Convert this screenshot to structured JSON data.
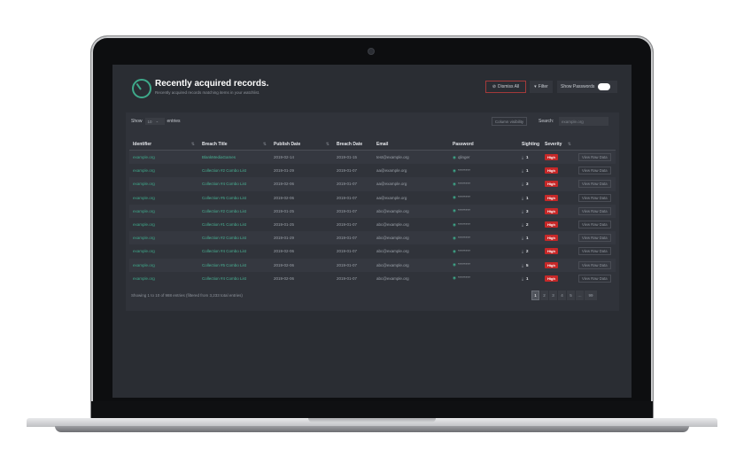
{
  "header": {
    "title": "Recently acquired records.",
    "subtitle": "Recently acquired records matching items in your watchlist.",
    "dismiss_label": "Dismiss All",
    "filter_label": "Filter",
    "show_passwords_label": "Show Passwords"
  },
  "controls": {
    "show_label": "Show",
    "entries_value": "10",
    "entries_label": "entries",
    "column_visibility_label": "Column visibility",
    "search_label": "Search:",
    "search_placeholder": "example.org"
  },
  "table": {
    "columns": [
      "Identifier",
      "Breach Title",
      "Publish Date",
      "Breach Date",
      "Email",
      "Password",
      "Sighting",
      "Severity",
      ""
    ],
    "rows": [
      {
        "identifier": "example.org",
        "breach": "BlankMediaGames",
        "publish": "2019-02-14",
        "breach_date": "2019-01-15",
        "email": "test@example.org",
        "password": "qlinger",
        "sighting": "1",
        "severity": "High",
        "action": "View Raw Data"
      },
      {
        "identifier": "example.org",
        "breach": "Collection #2 Combo List",
        "publish": "2019-01-29",
        "breach_date": "2019-01-07",
        "email": "aa@example.org",
        "password": "********",
        "sighting": "1",
        "severity": "High",
        "action": "View Raw Data"
      },
      {
        "identifier": "example.org",
        "breach": "Collection #4 Combo List",
        "publish": "2019-02-06",
        "breach_date": "2019-01-07",
        "email": "aa@example.org",
        "password": "********",
        "sighting": "3",
        "severity": "High",
        "action": "View Raw Data"
      },
      {
        "identifier": "example.org",
        "breach": "Collection #5 Combo List",
        "publish": "2019-02-06",
        "breach_date": "2019-01-07",
        "email": "aa@example.org",
        "password": "********",
        "sighting": "1",
        "severity": "High",
        "action": "View Raw Data"
      },
      {
        "identifier": "example.org",
        "breach": "Collection #2 Combo List",
        "publish": "2019-01-25",
        "breach_date": "2019-01-07",
        "email": "abc@example.org",
        "password": "********",
        "sighting": "3",
        "severity": "High",
        "action": "View Raw Data"
      },
      {
        "identifier": "example.org",
        "breach": "Collection #1 Combo List",
        "publish": "2019-01-25",
        "breach_date": "2019-01-07",
        "email": "abc@example.org",
        "password": "********",
        "sighting": "2",
        "severity": "High",
        "action": "View Raw Data"
      },
      {
        "identifier": "example.org",
        "breach": "Collection #2 Combo List",
        "publish": "2019-01-29",
        "breach_date": "2019-01-07",
        "email": "abc@example.org",
        "password": "********",
        "sighting": "1",
        "severity": "High",
        "action": "View Raw Data"
      },
      {
        "identifier": "example.org",
        "breach": "Collection #4 Combo List",
        "publish": "2019-02-06",
        "breach_date": "2019-01-07",
        "email": "abc@example.org",
        "password": "********",
        "sighting": "2",
        "severity": "High",
        "action": "View Raw Data"
      },
      {
        "identifier": "example.org",
        "breach": "Collection #5 Combo List",
        "publish": "2019-02-06",
        "breach_date": "2019-01-07",
        "email": "abc@example.org",
        "password": "********",
        "sighting": "5",
        "severity": "High",
        "action": "View Raw Data"
      },
      {
        "identifier": "example.org",
        "breach": "Collection #4 Combo List",
        "publish": "2019-02-06",
        "breach_date": "2019-01-07",
        "email": "abc@example.org",
        "password": "********",
        "sighting": "1",
        "severity": "High",
        "action": "View Raw Data"
      }
    ]
  },
  "footer": {
    "info": "Showing 1 to 10 of 988 entries (filtered from 3,233 total entries)",
    "pages": [
      "1",
      "2",
      "3",
      "4",
      "5",
      "…",
      "99"
    ],
    "active_page": "1"
  },
  "colors": {
    "accent": "#3ea98a",
    "severity_high": "#c62828",
    "background": "#2a2d33"
  }
}
